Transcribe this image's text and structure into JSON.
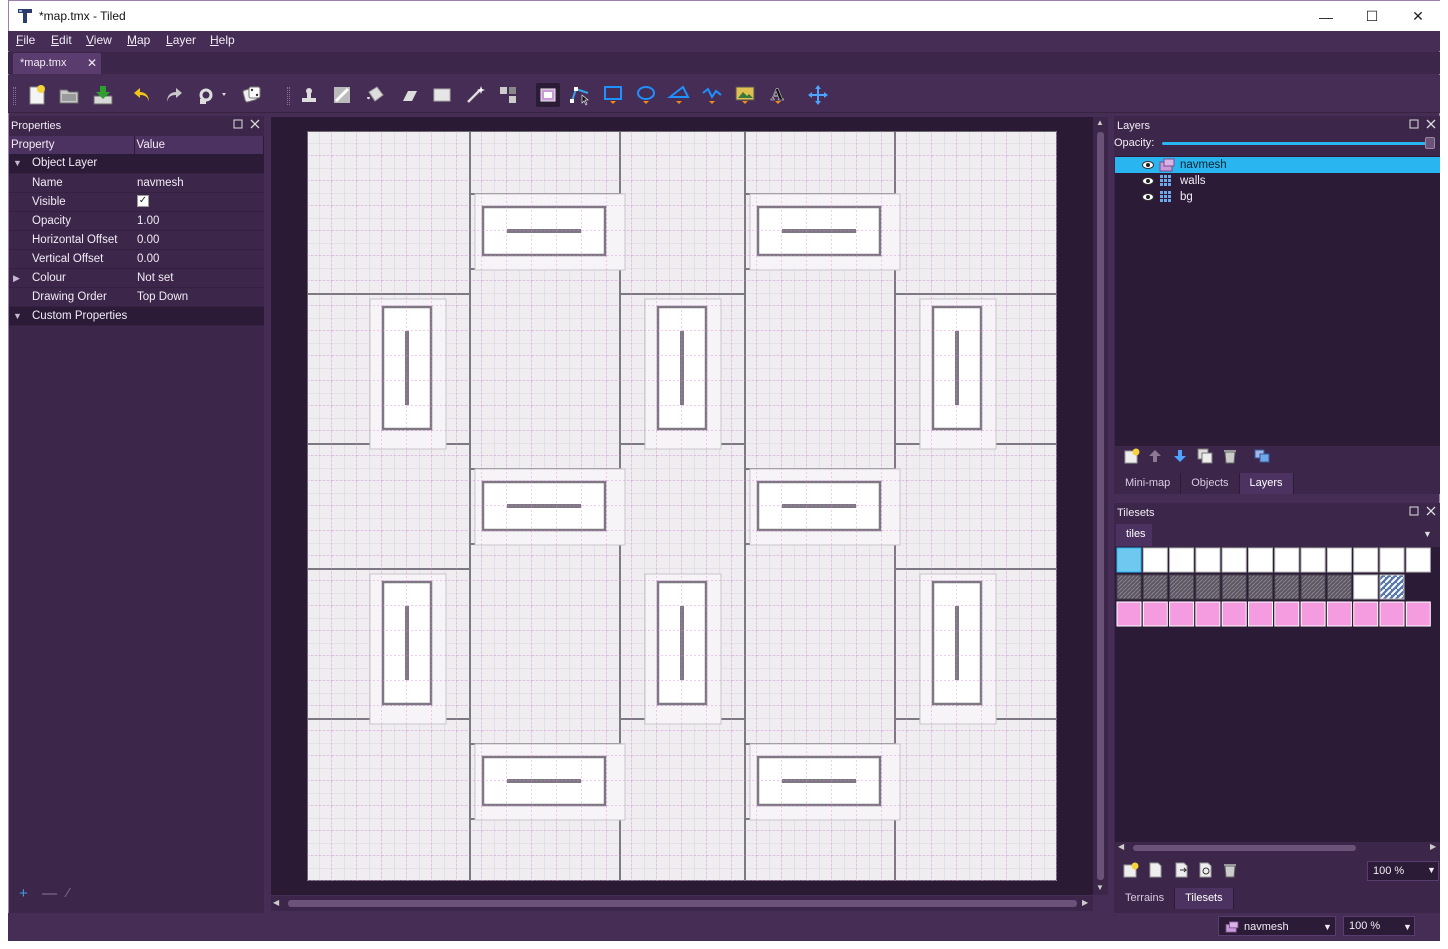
{
  "window": {
    "title": "*map.tmx - Tiled"
  },
  "menu": [
    "File",
    "Edit",
    "View",
    "Map",
    "Layer",
    "Help"
  ],
  "menu_hotkeys": [
    "F",
    "E",
    "V",
    "M",
    "L",
    "H"
  ],
  "tabs": [
    {
      "label": "*map.tmx"
    }
  ],
  "properties_panel": {
    "title": "Properties",
    "columns": [
      "Property",
      "Value"
    ],
    "group": "Object Layer",
    "rows": [
      {
        "key": "Name",
        "value": "navmesh"
      },
      {
        "key": "Visible",
        "value": "✓"
      },
      {
        "key": "Opacity",
        "value": "1.00"
      },
      {
        "key": "Horizontal Offset",
        "value": "0.00"
      },
      {
        "key": "Vertical Offset",
        "value": "0.00"
      },
      {
        "key": "Colour",
        "value": "Not set"
      },
      {
        "key": "Drawing Order",
        "value": "Top Down"
      }
    ],
    "custom_group": "Custom Properties"
  },
  "layers_panel": {
    "title": "Layers",
    "opacity_label": "Opacity:",
    "opacity": 1.0,
    "layers": [
      {
        "name": "navmesh",
        "type": "object",
        "selected": true
      },
      {
        "name": "walls",
        "type": "tile",
        "selected": false
      },
      {
        "name": "bg",
        "type": "tile",
        "selected": false
      }
    ],
    "tabs": [
      "Mini-map",
      "Objects",
      "Layers"
    ],
    "active_tab": "Layers"
  },
  "tilesets_panel": {
    "title": "Tilesets",
    "tileset_tab": "tiles",
    "zoom": "100 %",
    "tabs": [
      "Terrains",
      "Tilesets"
    ],
    "active_tab": "Tilesets"
  },
  "statusbar": {
    "current_layer": "navmesh",
    "zoom": "100 %"
  },
  "colors": {
    "accent": "#29b6f0",
    "panel_bg": "#3c2649",
    "window_bg": "#452d55"
  }
}
